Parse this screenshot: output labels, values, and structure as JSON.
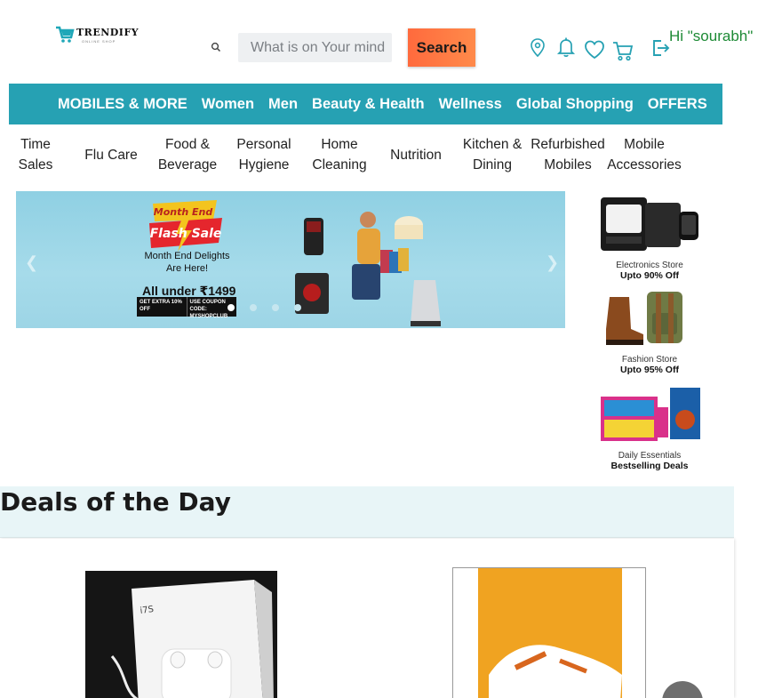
{
  "brand": {
    "name": "TRENDIFY",
    "tagline": "ONLINE SHOP"
  },
  "search": {
    "placeholder": "What is on Your mind",
    "button_label": "Search"
  },
  "header_icons": [
    "location-icon",
    "bell-icon",
    "heart-icon",
    "cart-icon",
    "logout-icon"
  ],
  "user": {
    "greeting": "Hi \"sourabh\""
  },
  "nav_primary": [
    "MOBILES & MORE",
    "Women",
    "Men",
    "Beauty & Health",
    "Wellness",
    "Global Shopping",
    "OFFERS"
  ],
  "nav_secondary": [
    [
      "Time Sales"
    ],
    [
      "Flu Care"
    ],
    [
      "Food &",
      "Beverage"
    ],
    [
      "Personal",
      "Hygiene"
    ],
    [
      "Home",
      "Cleaning"
    ],
    [
      "Nutrition"
    ],
    [
      "Kitchen &",
      "Dining"
    ],
    [
      "Refurbished",
      "Mobiles"
    ],
    [
      "Mobile",
      "Accessories"
    ]
  ],
  "banner": {
    "badge_top": "Month End",
    "badge_bottom": "Flash Sale",
    "line1": "Month End Delights",
    "line2": "Are Here!",
    "headline": "All under ₹1499",
    "coupon_left": "GET EXTRA 10% OFF",
    "coupon_right": "USE COUPON CODE: MYSHOPCLUB",
    "slides": 4,
    "active_slide": 0
  },
  "promos": [
    {
      "title": "Electronics Store",
      "offer": "Upto 90% Off"
    },
    {
      "title": "Fashion Store",
      "offer": "Upto 95% Off"
    },
    {
      "title": "Daily Essentials",
      "offer": "Bestselling Deals"
    }
  ],
  "deals": {
    "title": "Deals of the Day",
    "product1_label": "i7S"
  },
  "colors": {
    "accent": "#26a1b3",
    "search_button": "#ff7a45",
    "greeting": "#1d8a35"
  }
}
